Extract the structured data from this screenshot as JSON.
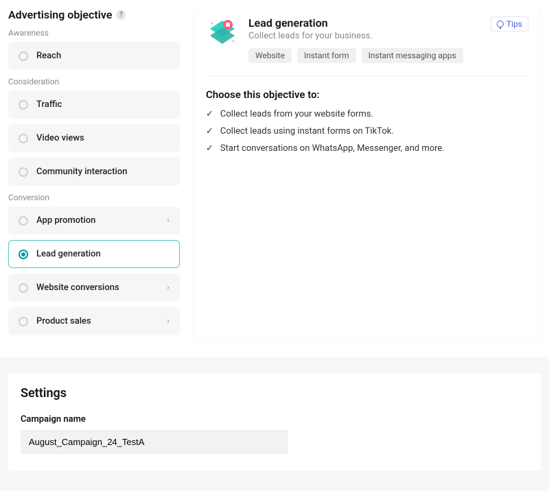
{
  "sidebar": {
    "title": "Advertising objective",
    "groups": [
      {
        "label": "Awareness",
        "items": [
          {
            "label": "Reach",
            "chevron": false,
            "selected": false
          }
        ]
      },
      {
        "label": "Consideration",
        "items": [
          {
            "label": "Traffic",
            "chevron": false,
            "selected": false
          },
          {
            "label": "Video views",
            "chevron": false,
            "selected": false
          },
          {
            "label": "Community interaction",
            "chevron": false,
            "selected": false
          }
        ]
      },
      {
        "label": "Conversion",
        "items": [
          {
            "label": "App promotion",
            "chevron": true,
            "selected": false
          },
          {
            "label": "Lead generation",
            "chevron": false,
            "selected": true
          },
          {
            "label": "Website conversions",
            "chevron": true,
            "selected": false
          },
          {
            "label": "Product sales",
            "chevron": true,
            "selected": false
          }
        ]
      }
    ]
  },
  "detail": {
    "title": "Lead generation",
    "subtitle": "Collect leads for your business.",
    "chips": [
      "Website",
      "Instant form",
      "Instant messaging apps"
    ],
    "tips_label": "Tips",
    "choose_title": "Choose this objective to:",
    "bullets": [
      "Collect leads from your website forms.",
      "Collect leads using instant forms on TikTok.",
      "Start conversations on WhatsApp, Messenger, and more."
    ]
  },
  "settings": {
    "title": "Settings",
    "campaign_name_label": "Campaign name",
    "campaign_name_value": "August_Campaign_24_TestA"
  }
}
